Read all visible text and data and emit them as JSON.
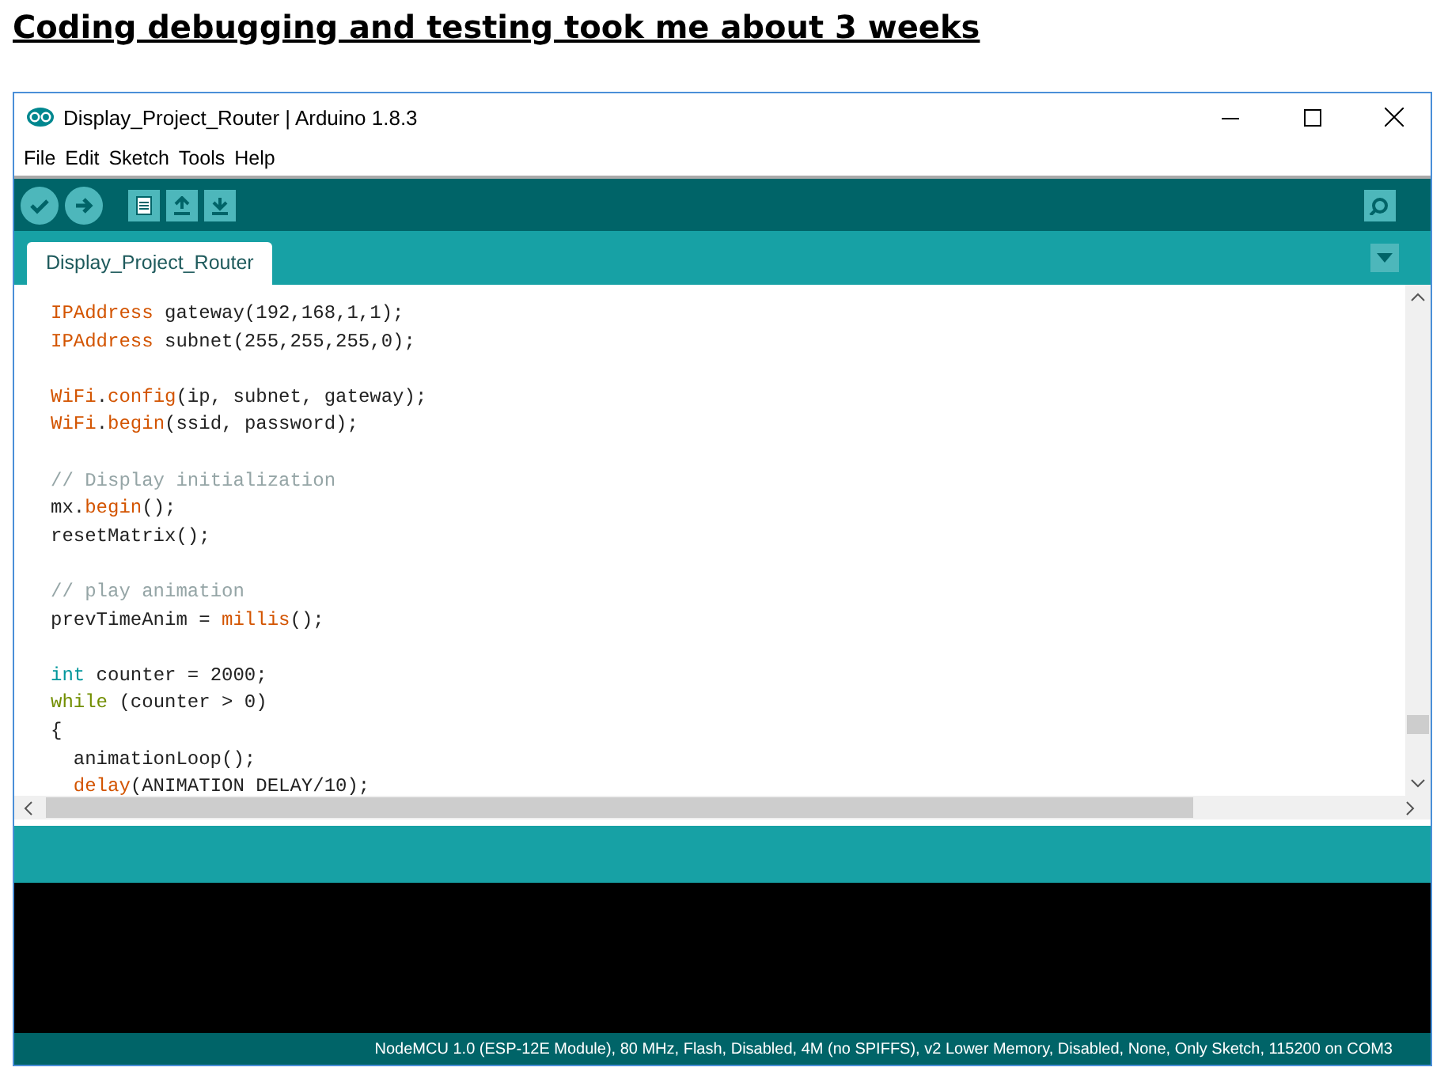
{
  "heading": "Coding debugging and testing took me about 3 weeks",
  "window": {
    "title": "Display_Project_Router | Arduino 1.8.3"
  },
  "menu": [
    {
      "label": "File"
    },
    {
      "label": "Edit"
    },
    {
      "label": "Sketch"
    },
    {
      "label": "Tools"
    },
    {
      "label": "Help"
    }
  ],
  "tabs": [
    {
      "label": "Display_Project_Router",
      "selected": true
    }
  ],
  "editor": {
    "lines": [
      {
        "kind": "code",
        "tokens": [
          {
            "kind": "type",
            "text": "IPAddress"
          },
          {
            "kind": "plain",
            "text": " gateway(192,168,1,1);"
          }
        ]
      },
      {
        "kind": "code",
        "tokens": [
          {
            "kind": "type",
            "text": "IPAddress"
          },
          {
            "kind": "plain",
            "text": " subnet(255,255,255,0);"
          }
        ]
      },
      {
        "kind": "blank"
      },
      {
        "kind": "code",
        "tokens": [
          {
            "kind": "type",
            "text": "WiFi"
          },
          {
            "kind": "plain",
            "text": "."
          },
          {
            "kind": "function",
            "text": "config"
          },
          {
            "kind": "plain",
            "text": "(ip, subnet, gateway);"
          }
        ]
      },
      {
        "kind": "code",
        "tokens": [
          {
            "kind": "type",
            "text": "WiFi"
          },
          {
            "kind": "plain",
            "text": "."
          },
          {
            "kind": "function",
            "text": "begin"
          },
          {
            "kind": "plain",
            "text": "(ssid, password);"
          }
        ]
      },
      {
        "kind": "blank"
      },
      {
        "kind": "code",
        "tokens": [
          {
            "kind": "comment",
            "text": "// Display initialization"
          }
        ]
      },
      {
        "kind": "code",
        "tokens": [
          {
            "kind": "plain",
            "text": "mx."
          },
          {
            "kind": "function",
            "text": "begin"
          },
          {
            "kind": "plain",
            "text": "();"
          }
        ]
      },
      {
        "kind": "code",
        "tokens": [
          {
            "kind": "plain",
            "text": "resetMatrix();"
          }
        ]
      },
      {
        "kind": "blank"
      },
      {
        "kind": "code",
        "tokens": [
          {
            "kind": "comment",
            "text": "// play animation"
          }
        ]
      },
      {
        "kind": "code",
        "tokens": [
          {
            "kind": "plain",
            "text": "prevTimeAnim = "
          },
          {
            "kind": "function",
            "text": "millis"
          },
          {
            "kind": "plain",
            "text": "();"
          }
        ]
      },
      {
        "kind": "blank"
      },
      {
        "kind": "code",
        "tokens": [
          {
            "kind": "datatype",
            "text": "int"
          },
          {
            "kind": "plain",
            "text": " counter = 2000;"
          }
        ]
      },
      {
        "kind": "code",
        "tokens": [
          {
            "kind": "control",
            "text": "while"
          },
          {
            "kind": "plain",
            "text": " (counter > 0)"
          }
        ]
      },
      {
        "kind": "code",
        "tokens": [
          {
            "kind": "plain",
            "text": "{"
          }
        ]
      },
      {
        "kind": "code",
        "indented": true,
        "tokens": [
          {
            "kind": "plain",
            "text": "animationLoop();"
          }
        ]
      },
      {
        "kind": "code",
        "indented": true,
        "tokens": [
          {
            "kind": "function",
            "text": "delay"
          },
          {
            "kind": "plain",
            "text": "(ANIMATION DELAY/10);"
          }
        ]
      }
    ]
  },
  "status_bar": "NodeMCU 1.0 (ESP-12E Module), 80 MHz, Flash, Disabled, 4M (no SPIFFS), v2 Lower Memory, Disabled, None, Only Sketch, 115200 on COM3"
}
